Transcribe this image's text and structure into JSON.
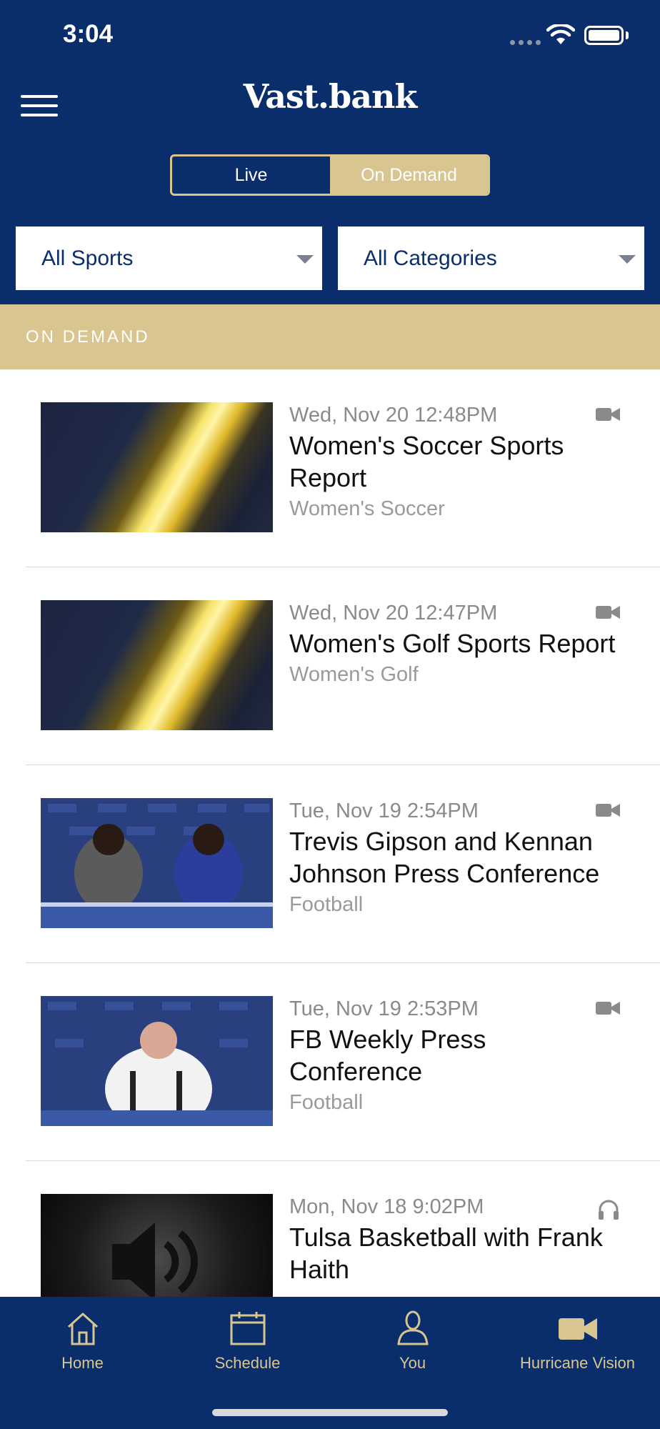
{
  "status": {
    "time": "3:04"
  },
  "header": {
    "logo": "Vast.bank"
  },
  "segmented": {
    "live_label": "Live",
    "on_demand_label": "On Demand",
    "selected": "On Demand"
  },
  "filters": {
    "sports": "All Sports",
    "categories": "All Categories"
  },
  "section": {
    "title": "ON DEMAND"
  },
  "items": [
    {
      "date": "Wed, Nov 20 12:48PM",
      "title": "Women's Soccer Sports Report",
      "sport": "Women's Soccer",
      "media_icon": "video-camera-icon"
    },
    {
      "date": "Wed, Nov 20 12:47PM",
      "title": "Women's Golf Sports Report",
      "sport": "Women's Golf",
      "media_icon": "video-camera-icon"
    },
    {
      "date": "Tue, Nov 19 2:54PM",
      "title": "Trevis Gipson and Kennan Johnson Press Conference",
      "sport": "Football",
      "media_icon": "video-camera-icon"
    },
    {
      "date": "Tue, Nov 19 2:53PM",
      "title": "FB Weekly Press Conference",
      "sport": "Football",
      "media_icon": "video-camera-icon"
    },
    {
      "date": "Mon, Nov 18 9:02PM",
      "title": "Tulsa Basketball with Frank Haith",
      "sport": "",
      "media_icon": "headphones-icon"
    }
  ],
  "tabs": [
    {
      "label": "Home",
      "icon": "home-icon"
    },
    {
      "label": "Schedule",
      "icon": "calendar-icon"
    },
    {
      "label": "You",
      "icon": "person-icon"
    },
    {
      "label": "Hurricane Vision",
      "icon": "video-camera-icon",
      "active": true
    }
  ],
  "colors": {
    "navy": "#0a2e6b",
    "gold": "#d9c58f"
  }
}
